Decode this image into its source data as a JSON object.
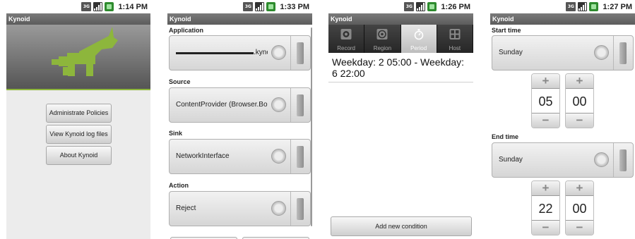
{
  "screens": [
    {
      "status_time": "1:14 PM",
      "title": "Kynoid",
      "buttons": [
        "Administrate Policies",
        "View Kynoid log files",
        "About Kynoid"
      ]
    },
    {
      "status_time": "1:33 PM",
      "title": "Kynoid",
      "fields": [
        {
          "label": "Application",
          "value": "▬▬▬▬▬▬▬▬▬▬▬.kynoid.evil"
        },
        {
          "label": "Source",
          "value": "ContentProvider (Browser.Bo"
        },
        {
          "label": "Sink",
          "value": "NetworkInterface"
        },
        {
          "label": "Action",
          "value": "Reject"
        }
      ]
    },
    {
      "status_time": "1:26 PM",
      "title": "Kynoid",
      "tabs": [
        {
          "label": "Record",
          "icon": "record-icon"
        },
        {
          "label": "Region",
          "icon": "region-icon"
        },
        {
          "label": "Period",
          "icon": "stopwatch-icon"
        },
        {
          "label": "Host",
          "icon": "host-icon"
        }
      ],
      "active_tab": "Period",
      "condition": "Weekday: 2 05:00 - Weekday: 6 22:00",
      "add_button": "Add new condition"
    },
    {
      "status_time": "1:27 PM",
      "title": "Kynoid",
      "start_label": "Start time",
      "start_day": "Sunday",
      "start_hour": "05",
      "start_minute": "00",
      "end_label": "End time",
      "end_day": "Sunday",
      "end_hour": "22",
      "end_minute": "00",
      "plus": "+",
      "minus": "−"
    }
  ],
  "status_icons": {
    "network": "3G",
    "signal": "signal-icon",
    "battery": "battery-icon"
  },
  "colors": {
    "title_bar": "#6b6b6b",
    "logo_green": "#8db63c",
    "banner_bg": "#7a7a7a"
  }
}
